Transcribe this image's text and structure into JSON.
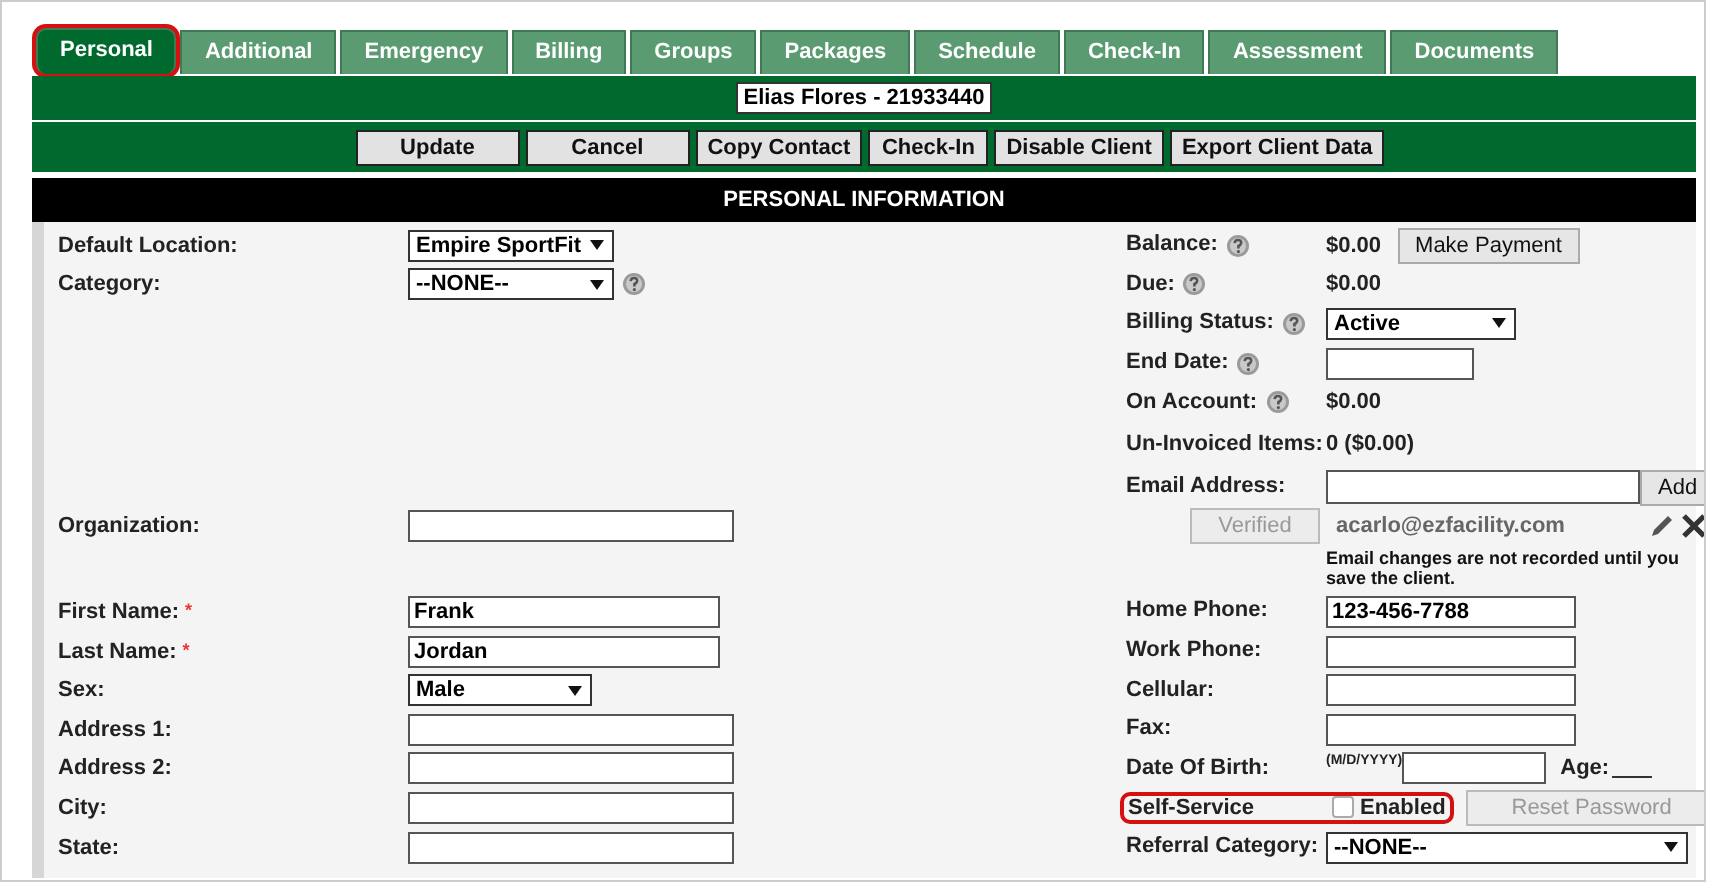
{
  "tabs": [
    {
      "label": "Personal",
      "selected": true,
      "highlighted": true
    },
    {
      "label": "Additional",
      "selected": false,
      "highlighted": false
    },
    {
      "label": "Emergency",
      "selected": false,
      "highlighted": false
    },
    {
      "label": "Billing",
      "selected": false,
      "highlighted": false
    },
    {
      "label": "Groups",
      "selected": false,
      "highlighted": false
    },
    {
      "label": "Packages",
      "selected": false,
      "highlighted": false
    },
    {
      "label": "Schedule",
      "selected": false,
      "highlighted": false
    },
    {
      "label": "Check-In",
      "selected": false,
      "highlighted": false
    },
    {
      "label": "Assessment",
      "selected": false,
      "highlighted": false
    },
    {
      "label": "Documents",
      "selected": false,
      "highlighted": false
    }
  ],
  "client_name": "Elias Flores - 21933440",
  "actions": [
    "Update",
    "Cancel",
    "Copy Contact",
    "Check-In",
    "Disable Client",
    "Export Client Data"
  ],
  "section_title": "PERSONAL INFORMATION",
  "rows": [
    {
      "left": {
        "kind": "select",
        "label": "Default Location:",
        "value": "Empire SportFit"
      },
      "right": {
        "kind": "value",
        "label": "Balance:",
        "help": true,
        "value": "$0.00",
        "button": "Make Payment"
      }
    },
    {
      "left": {
        "kind": "select",
        "label": "Category:",
        "value": "--NONE--",
        "help": true
      },
      "right": {
        "kind": "value",
        "label": "Due:",
        "help": true,
        "value": "$0.00"
      }
    },
    {
      "right": {
        "kind": "select",
        "label": "Billing Status:",
        "help": true,
        "value": "Active"
      }
    },
    {
      "right": {
        "kind": "text",
        "label": "End Date:",
        "help": true
      }
    },
    {
      "right": {
        "kind": "value",
        "label": "On Account:",
        "help": true,
        "value": "$0.00"
      }
    },
    {
      "right": {
        "kind": "value",
        "label": "Un-Invoiced Items:",
        "value": "0 ($0.00)"
      }
    },
    {
      "right": {
        "kind": "email",
        "label": "Email Address:",
        "button": "Add"
      }
    },
    {
      "left": {
        "kind": "text",
        "label": "Organization:"
      },
      "right": {
        "kind": "verified",
        "button": "Verified",
        "disabled": true,
        "email": "acarlo@ezfacility.com"
      }
    },
    {
      "right": {
        "kind": "note",
        "text": "Email changes are not recorded until you save the client."
      }
    },
    {
      "left": {
        "kind": "text",
        "label": "First Name:",
        "required_mark": "*",
        "value": "Frank"
      },
      "right": {
        "kind": "text",
        "label": "Home Phone:",
        "value": "123-456-7788"
      }
    },
    {
      "left": {
        "kind": "text",
        "label": "Last Name:",
        "required_mark": "*",
        "value": "Jordan"
      },
      "right": {
        "kind": "text",
        "label": "Work Phone:"
      }
    },
    {
      "left": {
        "kind": "select",
        "label": "Sex:",
        "value": "Male"
      },
      "right": {
        "kind": "text",
        "label": "Cellular:"
      }
    },
    {
      "left": {
        "kind": "text",
        "label": "Address 1:"
      },
      "right": {
        "kind": "text",
        "label": "Fax:"
      }
    },
    {
      "left": {
        "kind": "text",
        "label": "Address 2:"
      },
      "right": {
        "kind": "dob",
        "label": "Date Of Birth:",
        "hint": "(M/D/YYYY)",
        "age_label": "Age:"
      }
    },
    {
      "left": {
        "kind": "text",
        "label": "City:"
      },
      "right": {
        "kind": "checkbox",
        "label": "Self-Service",
        "checked": false,
        "option": "Enabled",
        "button": "Reset Password",
        "disabled": true,
        "highlighted": true
      }
    },
    {
      "left": {
        "kind": "text",
        "label": "State:"
      },
      "right": {
        "kind": "select",
        "label": "Referral Category:",
        "value": "--NONE--"
      }
    }
  ]
}
